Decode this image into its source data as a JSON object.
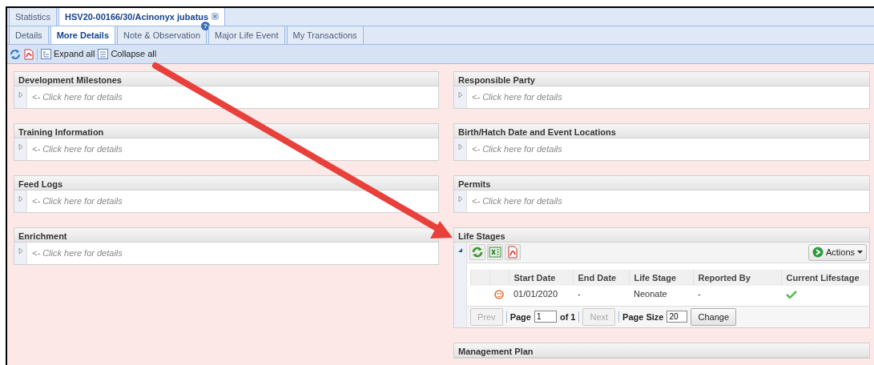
{
  "top_tabs": [
    {
      "label": "Statistics",
      "selected": false,
      "closable": false
    },
    {
      "label": "HSV20-00166/30/Acinonyx jubatus",
      "selected": true,
      "closable": true
    }
  ],
  "sub_tabs": [
    {
      "label": "Details",
      "selected": false,
      "help": false
    },
    {
      "label": "More Details",
      "selected": true,
      "help": false
    },
    {
      "label": "Note & Observation",
      "selected": false,
      "help": "?"
    },
    {
      "label": "Major Life Event",
      "selected": false,
      "help": false
    },
    {
      "label": "My Transactions",
      "selected": false,
      "help": false
    }
  ],
  "toolbar": [
    {
      "kind": "expand",
      "label": "Expand all"
    },
    {
      "kind": "collapse",
      "label": "Collapse all"
    }
  ],
  "left_panels": [
    {
      "title": "Development Milestones",
      "expanded": false,
      "hint": "<- Click here for details"
    },
    {
      "title": "Training Information",
      "expanded": false,
      "hint": "<- Click here for details"
    },
    {
      "title": "Feed Logs",
      "expanded": false,
      "hint": "<- Click here for details"
    },
    {
      "title": "Enrichment",
      "expanded": false,
      "hint": "<- Click here for details"
    }
  ],
  "right_panels": [
    {
      "title": "Responsible Party",
      "expanded": false,
      "hint": "<- Click here for details"
    },
    {
      "title": "Birth/Hatch Date and Event Locations",
      "expanded": false,
      "hint": "<- Click here for details"
    },
    {
      "title": "Permits",
      "expanded": false,
      "hint": "<- Click here for details"
    },
    {
      "title": "Life Stages",
      "expanded": true,
      "grid": {
        "actions": "Actions",
        "columns": [
          "Start Date",
          "End Date",
          "Life Stage",
          "Reported By",
          "Current Lifestage"
        ],
        "rows": [
          {
            "start_date": "01/01/2020",
            "end_date": "-",
            "life_stage": "Neonate",
            "reported_by": "-",
            "current": true
          }
        ],
        "pager": {
          "prev": "Prev",
          "page_label": "Page",
          "page": "1",
          "of": "of 1",
          "next": "Next",
          "size_label": "Page Size",
          "size": "20",
          "change": "Change"
        }
      }
    },
    {
      "title": "Management Plan"
    }
  ]
}
